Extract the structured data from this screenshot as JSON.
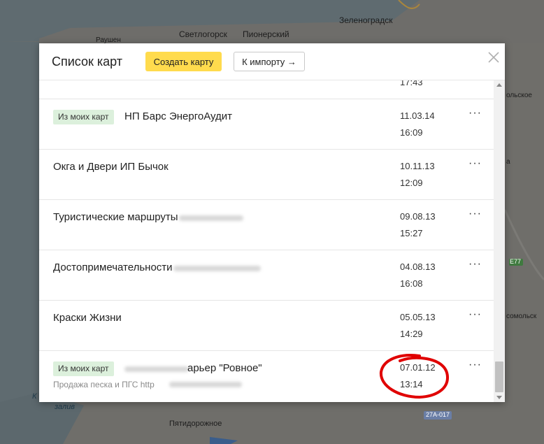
{
  "map": {
    "labels": {
      "svetlogorsk": "Светлогорск",
      "pionersky": "Пионерский",
      "zelenogradsk": "Зеленоградск",
      "rauschen": "Раушен",
      "road_e77": "E77",
      "road_27a017": "27А-017",
      "pyatidorozhnoe": "Пятидорожное",
      "zaliv": "залив",
      "k": "К",
      "alskoe": "ольское",
      "omsolsk": "сомольск",
      "sa": "а"
    }
  },
  "dialog": {
    "title": "Список карт",
    "create_button": "Создать карту",
    "import_button": "К импорту →",
    "close_icon": "close-icon"
  },
  "list": {
    "rows": [
      {
        "badge": "",
        "title": "",
        "subtitle": "",
        "date": "",
        "time": "17:43"
      },
      {
        "badge": "Из моих карт",
        "title": "НП Барс ЭнергоАудит",
        "subtitle": "",
        "date": "11.03.14",
        "time": "16:09"
      },
      {
        "badge": "",
        "title": "Окга и Двери ИП Бычок",
        "subtitle": "",
        "date": "10.11.13",
        "time": "12:09"
      },
      {
        "badge": "",
        "title": "Туристические маршруты",
        "subtitle": "",
        "date": "09.08.13",
        "time": "15:27"
      },
      {
        "badge": "",
        "title": "Достопримечательности",
        "subtitle": "",
        "date": "04.08.13",
        "time": "16:08"
      },
      {
        "badge": "",
        "title": "Краски Жизни",
        "subtitle": "",
        "date": "05.05.13",
        "time": "14:29"
      },
      {
        "badge": "Из моих карт",
        "title": "арьер \"Ровное\"",
        "subtitle": "Продажа песка и ПГС http",
        "date": "07.01.12",
        "time": "13:14"
      }
    ],
    "menu_label": "···"
  },
  "colors": {
    "accent_yellow": "#ffdb4d",
    "badge_green": "#dcf0dc",
    "annotation_red": "#e00000"
  }
}
